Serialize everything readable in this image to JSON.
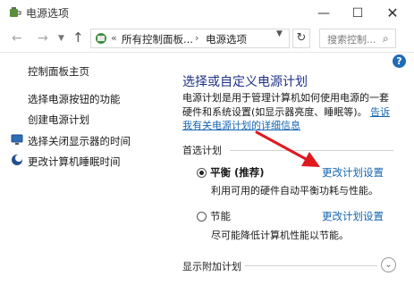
{
  "window": {
    "title": "电源选项",
    "minimize": "—",
    "maximize": "☐",
    "close": "✕"
  },
  "nav": {
    "back": "←",
    "forward": "→",
    "up": "↑",
    "breadcrumb_sep": "«",
    "breadcrumb": [
      "所有控制面板...",
      "电源选项"
    ],
    "breadcrumb_arrow": "›",
    "refresh": "↻",
    "search_placeholder": "搜索控制..."
  },
  "sidebar": {
    "items": [
      {
        "label": "控制面板主页",
        "icon": "none"
      },
      {
        "label": "选择电源按钮的功能",
        "icon": "none"
      },
      {
        "label": "创建电源计划",
        "icon": "none"
      },
      {
        "label": "选择关闭显示器的时间",
        "icon": "monitor-icon"
      },
      {
        "label": "更改计算机睡眠时间",
        "icon": "moon-icon"
      }
    ]
  },
  "main": {
    "title": "选择或自定义电源计划",
    "description": "电源计划是用于管理计算机如何使用电源的一套硬件和系统设置(如显示器亮度、睡眠等)。",
    "description_link": "告诉我有关电源计划的详细信息",
    "group_label": "首选计划",
    "plans": [
      {
        "name": "平衡 (推荐)",
        "selected": true,
        "link": "更改计划设置",
        "description": "利用可用的硬件自动平衡功耗与性能。"
      },
      {
        "name": "节能",
        "selected": false,
        "link": "更改计划设置",
        "description": "尽可能降低计算机性能以节能。"
      }
    ],
    "extra_label": "显示附加计划",
    "help": "?"
  },
  "colors": {
    "accent": "#1e3287",
    "link": "#1565b0",
    "annotation_arrow": "#e0191f"
  }
}
